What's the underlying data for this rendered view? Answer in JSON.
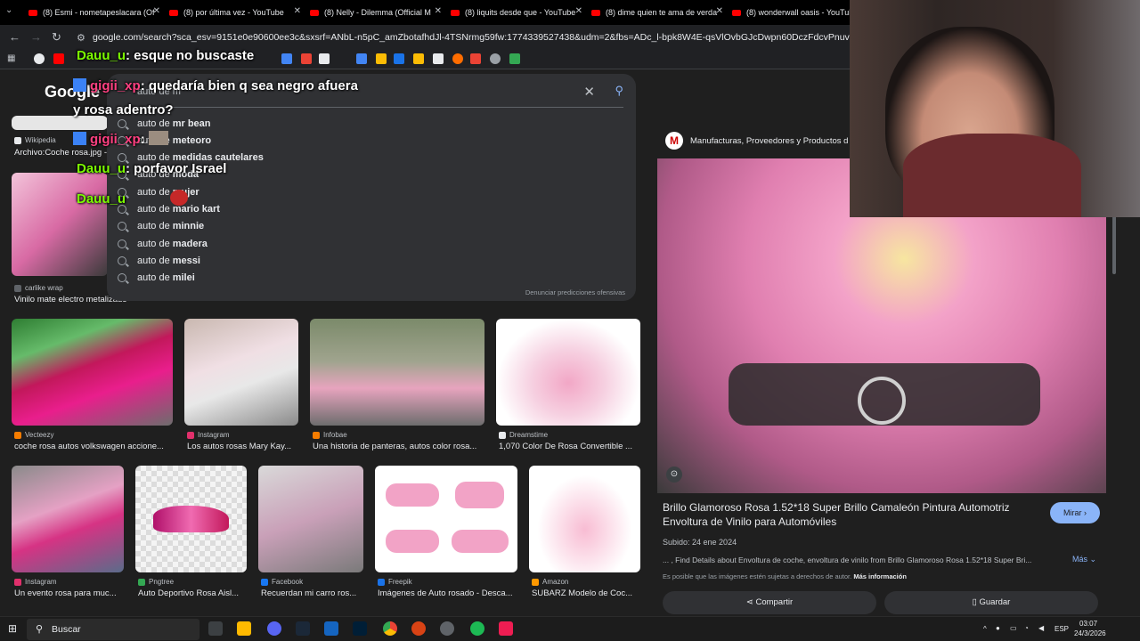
{
  "browser": {
    "tabs": [
      {
        "label": "(8) Esmi - nometapeslacara (Of"
      },
      {
        "label": "(8) por última vez - YouTube"
      },
      {
        "label": "(8) Nelly - Dilemma (Official M"
      },
      {
        "label": "(8) liquits desde que - YouTube"
      },
      {
        "label": "(8) dime quien te ama de verda"
      },
      {
        "label": "(8) wonderwall oasis - YouTube"
      }
    ],
    "url": "google.com/search?sca_esv=9151e0e90600ee3c&sxsrf=ANbL-n5pC_amZbotafhdJl-4TSNrmg59fw:1774339527438&udm=2&fbs=ADc_l-bpk8W4E-qsVlOvbGJcDwpn60DczFdcvPnuv8WQohHLTaf9fS4tJ71bi2aH"
  },
  "search": {
    "logo": "Google",
    "query": "auto de m",
    "suggestions": [
      {
        "prefix": "auto de",
        "bold": "mr bean"
      },
      {
        "prefix": "auto de",
        "bold": "meteoro"
      },
      {
        "prefix": "auto de",
        "bold": "medidas cautelares"
      },
      {
        "prefix": "auto de",
        "bold": "moda"
      },
      {
        "prefix": "auto de",
        "bold": "mujer"
      },
      {
        "prefix": "auto de",
        "bold": "mario kart"
      },
      {
        "prefix": "auto de",
        "bold": "minnie"
      },
      {
        "prefix": "auto de",
        "bold": "madera"
      },
      {
        "prefix": "auto de",
        "bold": "messi"
      },
      {
        "prefix": "auto de",
        "bold": "milei"
      }
    ],
    "report": "Denunciar predicciones ofensivas"
  },
  "chat": [
    {
      "user": "Dauu_u",
      "text": ": esque no buscaste"
    },
    {
      "user": "gigii_xp",
      "text": ": quedaría bien q sea negro afuera"
    },
    {
      "user": "",
      "text": "y rosa adentro?"
    },
    {
      "user": "gigii_xp",
      "text": ":"
    },
    {
      "user": "Dauu_u",
      "text": ": porfavor Israel"
    },
    {
      "user": "Dauu_u",
      "text": ""
    }
  ],
  "results_row0": [
    {
      "source": "Wikipedia",
      "caption": "Archivo:Coche rosa.jpg -"
    },
    {
      "source": "carlike wrap",
      "caption": "Vinilo mate electro metalizado"
    }
  ],
  "results_row1": [
    {
      "source": "Vecteezy",
      "caption": "coche rosa autos volkswagen accione..."
    },
    {
      "source": "Instagram",
      "caption": "Los autos rosas Mary Kay..."
    },
    {
      "source": "Infobae",
      "caption": "Una historia de panteras, autos color rosa..."
    },
    {
      "source": "Dreamstime",
      "caption": "1,070 Color De Rosa Convertible ..."
    }
  ],
  "results_row2": [
    {
      "source": "Instagram",
      "caption": "Un evento rosa para muc..."
    },
    {
      "source": "Pngtree",
      "caption": "Auto Deportivo Rosa Aisl..."
    },
    {
      "source": "Facebook",
      "caption": "Recuerdan mi carro ros..."
    },
    {
      "source": "Freepik",
      "caption": "Imágenes de Auto rosado - Desca..."
    },
    {
      "source": "Amazon",
      "caption": "SUBARZ Modelo de Coc..."
    }
  ],
  "preview": {
    "site": "Manufacturas, Proveedores y Productos d",
    "title": "Brillo Glamoroso Rosa 1.52*18 Super Brillo Camaleón Pintura Automotriz Envoltura de Vinilo para Automóviles",
    "mirar": "Mirar",
    "date": "Subido: 24 ene 2024",
    "desc": "... , Find Details about Envoltura de coche, envoltura de vinilo from Brillo Glamoroso Rosa 1.52*18 Super Bri...",
    "more": "Más",
    "legal": "Es posible que las imágenes estén sujetas a derechos de autor.",
    "legal_link": "Más información",
    "share": "Compartir",
    "save": "Guardar"
  },
  "taskbar": {
    "search": "Buscar",
    "lang": "ESP",
    "time": "03:07",
    "date": "24/3/2026"
  }
}
